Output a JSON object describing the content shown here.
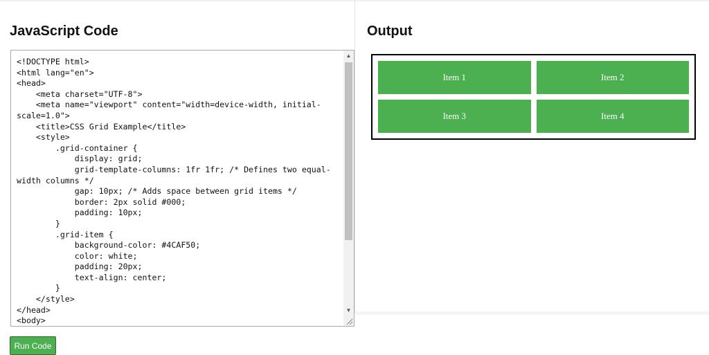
{
  "editor_panel": {
    "title": "JavaScript Code",
    "code": "<!DOCTYPE html>\n<html lang=\"en\">\n<head>\n    <meta charset=\"UTF-8\">\n    <meta name=\"viewport\" content=\"width=device-width, initial-scale=1.0\">\n    <title>CSS Grid Example</title>\n    <style>\n        .grid-container {\n            display: grid;\n            grid-template-columns: 1fr 1fr; /* Defines two equal-width columns */\n            gap: 10px; /* Adds space between grid items */\n            border: 2px solid #000;\n            padding: 10px;\n        }\n        .grid-item {\n            background-color: #4CAF50;\n            color: white;\n            padding: 20px;\n            text-align: center;\n        }\n    </style>\n</head>\n<body>",
    "run_button_label": "Run Code"
  },
  "output_panel": {
    "title": "Output",
    "items": [
      "Item 1",
      "Item 2",
      "Item 3",
      "Item 4"
    ]
  },
  "colors": {
    "grid_item_bg": "#4CAF50",
    "run_button_bg": "#4CAF50"
  },
  "icons": {
    "scroll_up": "triangle-up",
    "scroll_down": "triangle-down",
    "resize": "resize-grip"
  }
}
